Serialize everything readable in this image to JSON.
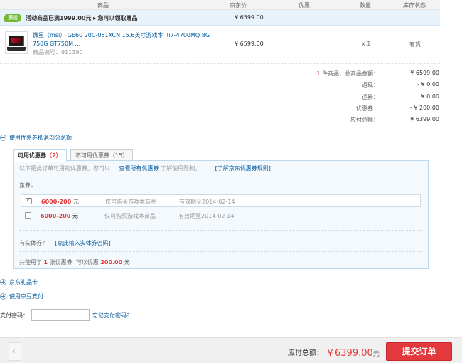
{
  "table_header": {
    "product": "商品",
    "jd_price": "京东价",
    "discount": "优惠",
    "quantity": "数量",
    "stock_status": "库存状态"
  },
  "promo": {
    "badge": "满赠",
    "text": "活动商品已满1999.00元",
    "link": "您可以领取赠品",
    "price": "¥ 6599.00"
  },
  "product": {
    "name": "微星（msi） GE60 20C-051XCN 15.6英寸游戏本（i7-4700MQ 8G 750G GT750M ...",
    "code": "商品编号：911390",
    "price": "¥ 6599.00",
    "quantity": "x 1",
    "stock": "有货"
  },
  "summary": {
    "count_prefix": "1",
    "count_label": "件商品，总商品金额：",
    "total_goods": "¥ 6599.00",
    "cashback_label": "返现：",
    "cashback": "- ¥ 0.00",
    "shipping_label": "运费：",
    "shipping": "¥ 0.00",
    "coupon_label": "优惠券：",
    "coupon": "- ¥ 200.00",
    "payable_label": "应付总额：",
    "payable": "¥ 6399.00"
  },
  "coupon_section": {
    "toggle_label": "使用优惠券抵消部分总额",
    "tab_available_label": "可用优惠券",
    "tab_available_count": "（2）",
    "tab_unavailable_label": "不可用优惠券",
    "tab_unavailable_count": "（15）",
    "note_prefix": "以下是此订单可用的优惠券。您可以",
    "note_link": "查看所有优惠券",
    "note_suffix": "了解使用限制。",
    "rules_link": "[了解京东优惠券规则]",
    "dongquan_label": "东券：",
    "coupons": [
      {
        "amount": "6000-200",
        "unit": "元",
        "scope": "仅可购买游戏本商品",
        "valid": "有效期至2014-02-14",
        "checked": true
      },
      {
        "amount": "6000-200",
        "unit": "元",
        "scope": "仅可购买游戏本商品",
        "valid": "有效期至2014-02-14",
        "checked": false
      }
    ],
    "entity_label": "有实体券？",
    "entity_link": "[点此输入实体券密码]",
    "used_prefix": "共使用了",
    "used_count": "1",
    "used_mid": "张优惠券",
    "used_save_prefix": "可以优惠",
    "used_save": "200.00",
    "used_suffix": "元"
  },
  "giftcard_toggle": "京东礼品卡",
  "jingdou_toggle": "使用京豆支付",
  "pay_password": {
    "label": "支付密码：",
    "forgot": "忘记支付密码？"
  },
  "footer": {
    "payable_label": "应付总额：",
    "payable_amount": "￥6399.00",
    "unit": "元",
    "submit": "提交订单"
  }
}
